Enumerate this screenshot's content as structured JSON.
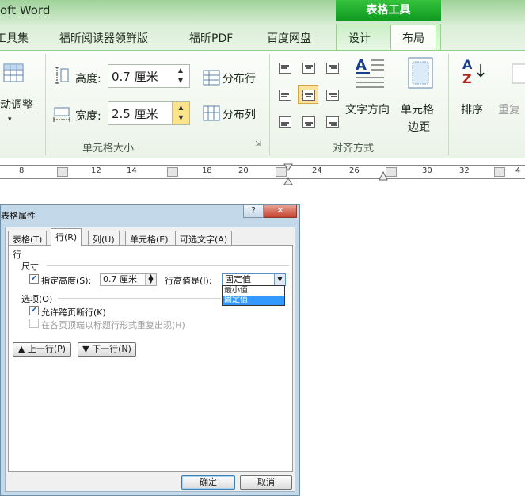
{
  "titlebar": {
    "app_title": "oft Word",
    "context_tab": "表格工具"
  },
  "tabs": [
    {
      "label": "工具集"
    },
    {
      "label": "福昕阅读器领鲜版"
    },
    {
      "label": "福昕PDF"
    },
    {
      "label": "百度网盘"
    },
    {
      "label": "设计"
    },
    {
      "label": "布局",
      "active": true
    }
  ],
  "ribbon": {
    "autofit_label": "动调整",
    "height_label": "高度:",
    "height_value": "0.7 厘米",
    "width_label": "宽度:",
    "width_value": "2.5 厘米",
    "distribute_rows": "分布行",
    "distribute_cols": "分布列",
    "group_cell_size": "单元格大小",
    "text_direction": "文字方向",
    "cell_margins_1": "单元格",
    "cell_margins_2": "边距",
    "group_alignment": "对齐方式",
    "sort": "排序",
    "repeat": "重复",
    "sort_glyph_top": "A",
    "sort_glyph_bottom": "Z"
  },
  "ruler": {
    "marks": [
      "8",
      "12",
      "14",
      "18",
      "20",
      "24",
      "26",
      "30",
      "32",
      "4"
    ]
  },
  "dialog": {
    "title": "表格属性",
    "help": "?",
    "close": "✕",
    "tabs": [
      "表格(T)",
      "行(R)",
      "列(U)",
      "单元格(E)",
      "可选文字(A)"
    ],
    "section_row": "行",
    "size_heading": "尺寸",
    "specify_height_label": "指定高度(S):",
    "specify_height_value": "0.7 厘米",
    "row_height_is_label": "行高值是(I):",
    "row_height_mode": "固定值",
    "dropdown_options": [
      "最小值",
      "固定值"
    ],
    "options_heading": "选项(O)",
    "allow_break": "允许跨页断行(K)",
    "repeat_header": "在各页顶端以标题行形式重复出现(H)",
    "prev_row": "上一行(P)",
    "next_row": "下一行(N)",
    "ok": "确定",
    "cancel": "取消"
  },
  "colors": {
    "context_green": "#1aa42a",
    "selection_blue": "#3399ff",
    "accent_gold": "#fbe29a"
  }
}
